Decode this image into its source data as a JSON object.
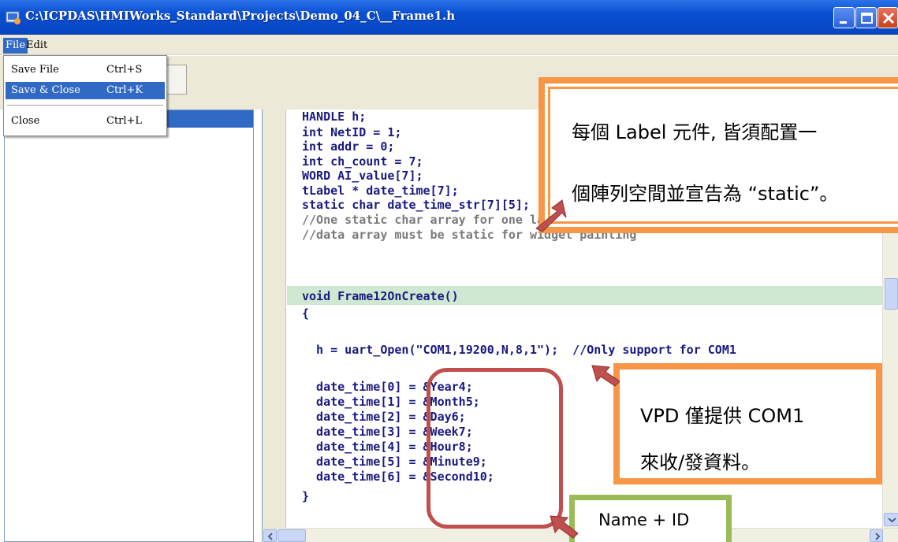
{
  "window": {
    "title": "C:\\ICPDAS\\HMIWorks_Standard\\Projects\\Demo_04_C\\__Frame1.h",
    "app_icon": "hmiworks-app-icon",
    "controls": [
      "minimize",
      "maximize",
      "close"
    ]
  },
  "menubar": {
    "file_label": "File",
    "edit_label": "Edit"
  },
  "file_menu": {
    "items": [
      {
        "label": "Save File",
        "shortcut": "Ctrl+S",
        "selected": false
      },
      {
        "label": "Save & Close",
        "shortcut": "Ctrl+K",
        "selected": true
      },
      {
        "label": "Close",
        "shortcut": "Ctrl+L",
        "selected": false
      }
    ]
  },
  "code": {
    "lines": [
      "HANDLE h;",
      "int NetID = 1;",
      "int addr = 0;",
      "int ch_count = 7;",
      "WORD AI_value[7];",
      "tLabel * date_time[7];",
      "static char date_time_str[7][5];",
      "//One static char array for one label;",
      "//data array must be static for widget painting",
      "",
      "void Frame12OnCreate()",
      "{",
      "",
      "  h = uart_Open(\"COM1,19200,N,8,1\");  //Only support for COM1",
      "",
      "  date_time[0] = &Year4;",
      "  date_time[1] = &Month5;",
      "  date_time[2] = &Day6;",
      "  date_time[3] = &Week7;",
      "  date_time[4] = &Hour8;",
      "  date_time[5] = &Minute9;",
      "  date_time[6] = &Second10;",
      "}"
    ]
  },
  "callouts": {
    "static_note_line1": "每個 Label 元件, 皆須配置一",
    "static_note_line2": "個陣列空間並宣告為 “static”。",
    "com1_note_line1": "VPD 僅提供 COM1",
    "com1_note_line2": "來收/發資料。",
    "name_id_note": "Name + ID"
  },
  "colors": {
    "title_bar": "#0a4fd1",
    "menu_highlight": "#316ac5",
    "callout_orange": "#f79646",
    "callout_green": "#9bbb59",
    "bracket_red": "#c0504d",
    "current_line": "#cfe8d2"
  }
}
